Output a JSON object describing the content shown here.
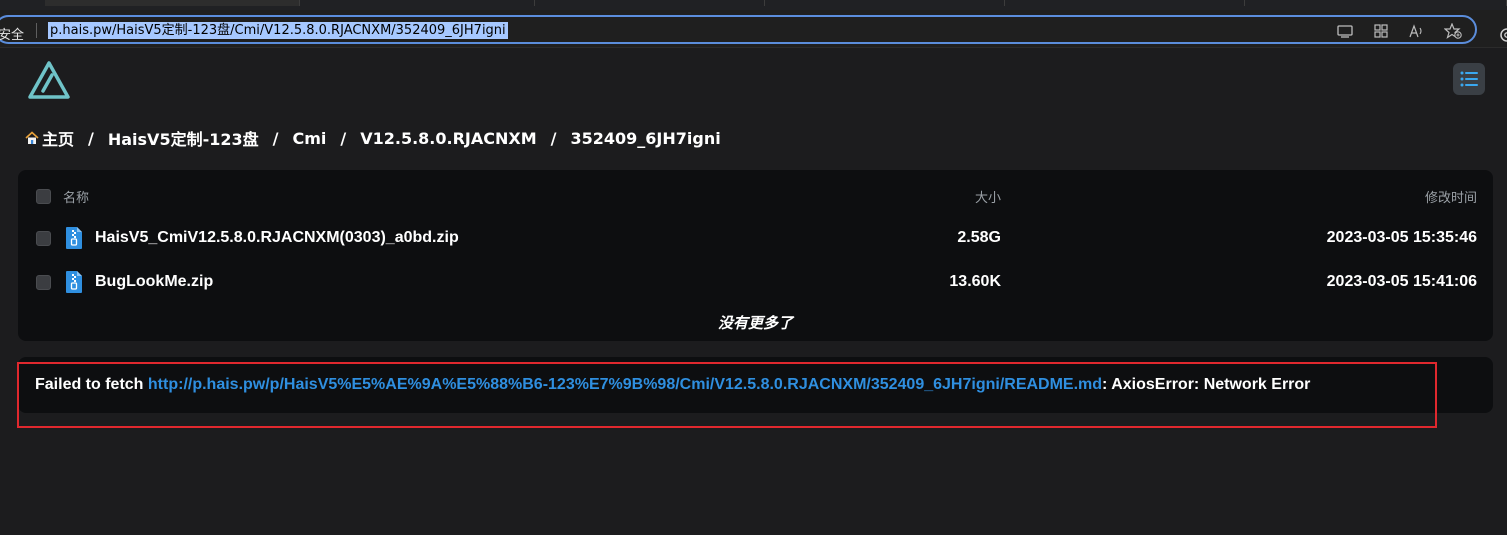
{
  "browser": {
    "security_label": "安全",
    "url": "p.hais.pw/HaisV5定制-123盘/Cmi/V12.5.8.0.RJACNXM/352409_6JH7igni",
    "icons": [
      "reading-mode-icon",
      "app-grid-icon",
      "read-aloud-icon",
      "favorite-add-icon",
      "settings-gear-icon"
    ]
  },
  "header": {
    "logo_name": "alist-logo",
    "menu_icon": "list-menu-icon"
  },
  "breadcrumb": {
    "items": [
      "主页",
      "HaisV5定制-123盘",
      "Cmi",
      "V12.5.8.0.RJACNXM",
      "352409_6JH7igni"
    ],
    "separator": "/"
  },
  "file_list": {
    "columns": {
      "name": "名称",
      "size": "大小",
      "modified": "修改时间"
    },
    "rows": [
      {
        "name": "HaisV5_CmiV12.5.8.0.RJACNXM(0303)_a0bd.zip",
        "size": "2.58G",
        "modified": "2023-03-05 15:35:46"
      },
      {
        "name": "BugLookMe.zip",
        "size": "13.60K",
        "modified": "2023-03-05 15:41:06"
      }
    ],
    "footer": "没有更多了"
  },
  "readme": {
    "prefix": "Failed to fetch ",
    "link": "http://p.hais.pw/p/HaisV5%E5%AE%9A%E5%88%B6-123%E7%9B%98/Cmi/V12.5.8.0.RJACNXM/352409_6JH7igni/README.md",
    "suffix": ": AxiosError: Network Error"
  },
  "colors": {
    "accent": "#2f8fe0",
    "logo": "#6fc3c8",
    "highlight": "#e0282e",
    "panel": "#0d0e10",
    "background": "#1c1c1e"
  }
}
